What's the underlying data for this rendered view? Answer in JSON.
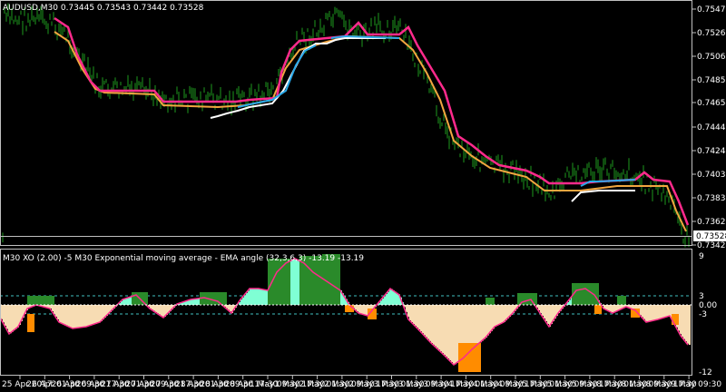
{
  "main_panel": {
    "header": "AUDUSD,M30  0.73445 0.73543 0.73442 0.73528",
    "price_levels": [
      "0.75471",
      "0.75267",
      "0.75062",
      "0.74858",
      "0.74654",
      "0.74449",
      "0.74244",
      "0.74039",
      "0.73834",
      "0.73629",
      "0.73424"
    ],
    "current_price": "0.73528"
  },
  "sub_panel": {
    "header": "M30 XO (2.00) -5  M30 Exponential moving average - EMA angle (32,3,6,3) -13.19 -13.19",
    "levels": [
      "9",
      "3",
      "0.00",
      "-3",
      "-12"
    ]
  },
  "time_axis": [
    "25 Apr 2017",
    "26 Apr 01:30",
    "26 Apr 09:30",
    "26 Apr 17:30",
    "27 Apr 01:30",
    "27 Apr 09:30",
    "27 Apr 17:30",
    "28 Apr 01:30",
    "28 Apr 09:30",
    "28 Apr 17:30",
    "1 May 09:30",
    "1 May 17:30",
    "2 May 01:30",
    "2 May 09:30",
    "2 May 17:30",
    "3 May 01:30",
    "3 May 09:30",
    "3 May 17:30",
    "4 May 01:30",
    "4 May 09:30",
    "4 May 17:30",
    "5 May 01:30",
    "5 May 09:30",
    "5 May 17:30",
    "8 May 01:30",
    "8 May 09:30",
    "8 May 17:30",
    "9 May 09:30"
  ],
  "colors": {
    "background": "#000000",
    "candles": "#1e9a1e",
    "ma_pink": "#ff2a8c",
    "ma_orange": "#f2a640",
    "line_blue": "#29a8e8",
    "line_white": "#ffffff",
    "hist_light": "#f7dcb3",
    "hist_orange": "#ff8c00",
    "hist_aqua": "#7fffd4",
    "hist_green": "#2a8a2a",
    "angle_line": "#ff2a8c"
  }
}
